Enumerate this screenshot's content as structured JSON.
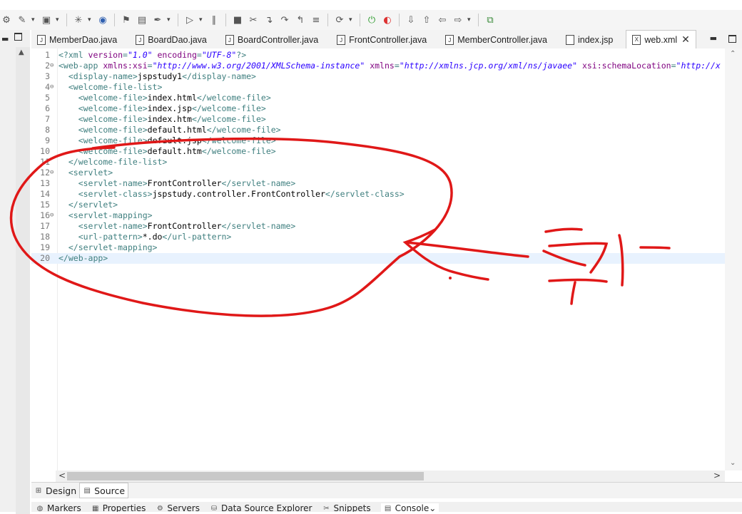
{
  "toolbar": {
    "icons": [
      "gear-icon",
      "run-icon",
      "folder-open-icon",
      "debug-icon",
      "globe-icon",
      "team-icon",
      "console-icon",
      "pin-icon",
      "resume-icon",
      "suspend-icon",
      "stop-icon",
      "disconnect-icon",
      "step-into-icon",
      "step-over-icon",
      "step-return-icon",
      "drop-frame-icon",
      "coverage-icon",
      "run-green-icon",
      "external-tools-icon",
      "next-annotation-icon",
      "prev-annotation-icon",
      "back-icon",
      "forward-icon",
      "new-window-icon"
    ]
  },
  "editor_tabs": [
    {
      "label": "MemberDao.java",
      "type": "J"
    },
    {
      "label": "BoardDao.java",
      "type": "J"
    },
    {
      "label": "BoardController.java",
      "type": "J"
    },
    {
      "label": "FrontController.java",
      "type": "J"
    },
    {
      "label": "MemberController.java",
      "type": "J"
    },
    {
      "label": "index.jsp",
      "type": "jsp"
    },
    {
      "label": "web.xml",
      "type": "X",
      "active": true
    }
  ],
  "code_lines": [
    {
      "n": "1",
      "fold": "",
      "html": "<span class='tag'>&lt;?xml </span><span class='attr'>version</span><span class='tag'>=</span><span class='val'>\"1.0\"</span><span class='attr'> encoding</span><span class='tag'>=</span><span class='val'>\"UTF-8\"</span><span class='tag'>?&gt;</span>"
    },
    {
      "n": "2",
      "fold": "⊖",
      "html": "<span class='tag'>&lt;web-app </span><span class='attr'>xmlns:xsi</span><span class='tag'>=</span><span class='val'>\"http://www.w3.org/2001/XMLSchema-instance\"</span><span class='attr'> xmlns</span><span class='tag'>=</span><span class='val'>\"http://xmlns.jcp.org/xml/ns/javaee\"</span><span class='attr'> xsi:schemaLocation</span><span class='tag'>=</span><span class='val'>\"http://x</span>"
    },
    {
      "n": "3",
      "fold": "",
      "html": "  <span class='tag'>&lt;display-name&gt;</span><span class='txt'>jspstudy1</span><span class='tag'>&lt;/display-name&gt;</span>"
    },
    {
      "n": "4",
      "fold": "⊖",
      "html": "  <span class='tag'>&lt;welcome-file-list&gt;</span>"
    },
    {
      "n": "5",
      "fold": "",
      "html": "    <span class='tag'>&lt;welcome-file&gt;</span><span class='txt'>index.html</span><span class='tag'>&lt;/welcome-file&gt;</span>"
    },
    {
      "n": "6",
      "fold": "",
      "html": "    <span class='tag'>&lt;welcome-file&gt;</span><span class='txt'>index.jsp</span><span class='tag'>&lt;/welcome-file&gt;</span>"
    },
    {
      "n": "7",
      "fold": "",
      "html": "    <span class='tag'>&lt;welcome-file&gt;</span><span class='txt'>index.htm</span><span class='tag'>&lt;/welcome-file&gt;</span>"
    },
    {
      "n": "8",
      "fold": "",
      "html": "    <span class='tag'>&lt;welcome-file&gt;</span><span class='txt'>default.html</span><span class='tag'>&lt;/welcome-file&gt;</span>"
    },
    {
      "n": "9",
      "fold": "",
      "html": "    <span class='tag'>&lt;welcome-file&gt;</span><span class='txt'>default.jsp</span><span class='tag'>&lt;/welcome-file&gt;</span>"
    },
    {
      "n": "10",
      "fold": "",
      "html": "    <span class='tag'>&lt;welcome-file&gt;</span><span class='txt'>default.htm</span><span class='tag'>&lt;/welcome-file&gt;</span>"
    },
    {
      "n": "11",
      "fold": "",
      "html": "  <span class='tag'>&lt;/welcome-file-list&gt;</span>"
    },
    {
      "n": "12",
      "fold": "⊖",
      "html": "  <span class='tag'>&lt;servlet&gt;</span>"
    },
    {
      "n": "13",
      "fold": "",
      "html": "    <span class='tag'>&lt;servlet-name&gt;</span><span class='txt'>FrontController</span><span class='tag'>&lt;/servlet-name&gt;</span>"
    },
    {
      "n": "14",
      "fold": "",
      "html": "    <span class='tag'>&lt;servlet-class&gt;</span><span class='txt'>jspstudy.controller.FrontController</span><span class='tag'>&lt;/servlet-class&gt;</span>"
    },
    {
      "n": "15",
      "fold": "",
      "html": "  <span class='tag'>&lt;/servlet&gt;</span>"
    },
    {
      "n": "16",
      "fold": "⊖",
      "html": "  <span class='tag'>&lt;servlet-mapping&gt;</span>"
    },
    {
      "n": "17",
      "fold": "",
      "html": "    <span class='tag'>&lt;servlet-name&gt;</span><span class='txt'>FrontController</span><span class='tag'>&lt;/servlet-name&gt;</span>"
    },
    {
      "n": "18",
      "fold": "",
      "html": "    <span class='tag'>&lt;url-pattern&gt;</span><span class='txt'>*.do</span><span class='tag'>&lt;/url-pattern&gt;</span>"
    },
    {
      "n": "19",
      "fold": "",
      "html": "  <span class='tag'>&lt;/servlet-mapping&gt;</span>"
    },
    {
      "n": "20",
      "fold": "",
      "html": "<span class='tag'>&lt;/web-app&gt;</span>",
      "current": true
    }
  ],
  "bottom_tabs": [
    {
      "label": "Design",
      "icon": "design-icon"
    },
    {
      "label": "Source",
      "icon": "source-icon",
      "active": true
    }
  ],
  "views": [
    {
      "label": "Markers",
      "icon": "markers-icon"
    },
    {
      "label": "Properties",
      "icon": "properties-icon"
    },
    {
      "label": "Servers",
      "icon": "servers-icon"
    },
    {
      "label": "Data Source Explorer",
      "icon": "datasource-icon"
    },
    {
      "label": "Snippets",
      "icon": "snippets-icon"
    },
    {
      "label": "Console",
      "icon": "console-icon",
      "active": true
    }
  ],
  "annotation": {
    "text": "추가",
    "color": "#e01818"
  }
}
